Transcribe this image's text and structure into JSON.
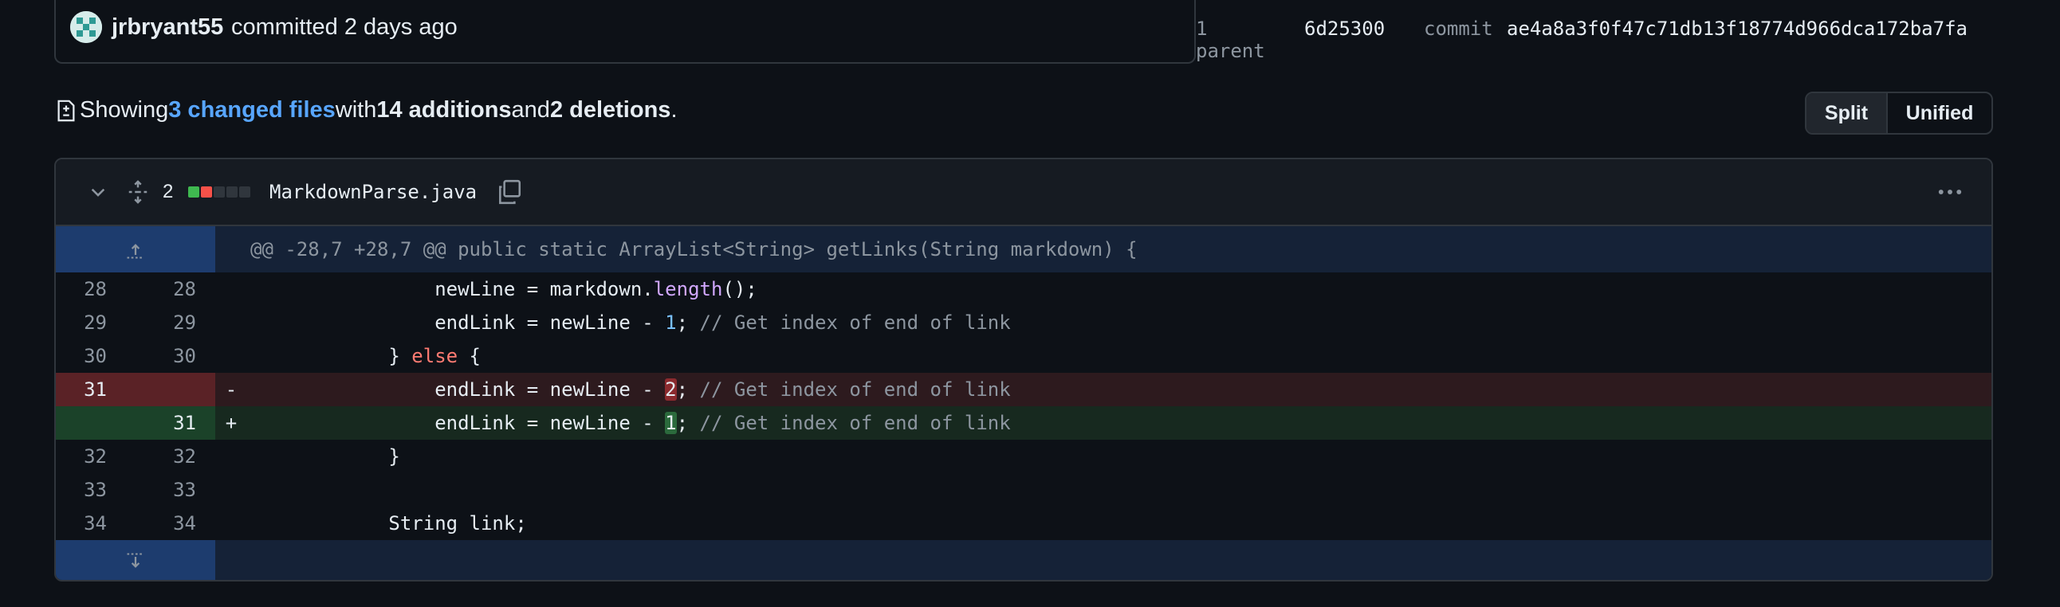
{
  "commit": {
    "author": "jrbryant55",
    "committed_text": "committed 2 days ago",
    "parent_label": "1 parent",
    "parent_sha": "6d25300",
    "commit_label": "commit",
    "commit_sha": "ae4a8a3f0f47c71db13f18774d966dca172ba7fa"
  },
  "summary": {
    "prefix": "Showing ",
    "files_link": "3 changed files",
    "with": " with ",
    "additions": "14 additions",
    "and": " and ",
    "deletions": "2 deletions",
    "suffix": "."
  },
  "view_toggle": {
    "split": "Split",
    "unified": "Unified"
  },
  "file": {
    "changes": "2",
    "name": "MarkdownParse.java",
    "diffstat": [
      "#3fb950",
      "#f85149",
      "#30363d",
      "#30363d",
      "#30363d"
    ],
    "hunk_header": "@@ -28,7 +28,7 @@ public static ArrayList<String> getLinks(String markdown) {",
    "lines": [
      {
        "type": "ctx",
        "old": "28",
        "new": "28"
      },
      {
        "type": "ctx",
        "old": "29",
        "new": "29"
      },
      {
        "type": "ctx",
        "old": "30",
        "new": "30"
      },
      {
        "type": "del",
        "old": "31",
        "new": "",
        "marker": "-"
      },
      {
        "type": "add",
        "old": "",
        "new": "31",
        "marker": "+"
      },
      {
        "type": "ctx",
        "old": "32",
        "new": "32"
      },
      {
        "type": "ctx",
        "old": "33",
        "new": "33"
      },
      {
        "type": "ctx",
        "old": "34",
        "new": "34"
      }
    ],
    "code": {
      "l28": {
        "indent": "                ",
        "a": "newLine = markdown.",
        "fn": "length",
        "b": "();"
      },
      "l29": {
        "indent": "                ",
        "a": "endLink = newLine - ",
        "num": "1",
        "b": "; ",
        "comment": "// Get index of end of link"
      },
      "l30": {
        "indent": "            ",
        "a": "} ",
        "kw": "else",
        "b": " {"
      },
      "l31d": {
        "indent": "                ",
        "a": "endLink = newLine - ",
        "num": "2",
        "b": "; ",
        "comment": "// Get index of end of link"
      },
      "l31a": {
        "indent": "                ",
        "a": "endLink = newLine - ",
        "num": "1",
        "b": "; ",
        "comment": "// Get index of end of link"
      },
      "l32": {
        "indent": "            ",
        "a": "}"
      },
      "l33": {
        "indent": ""
      },
      "l34": {
        "indent": "            ",
        "a": "String link;"
      }
    }
  },
  "icons": {
    "avatar": "identicon-avatar",
    "summary": "file-diff-icon",
    "collapse": "chevron-down-icon",
    "expand": "unfold-icon",
    "copy": "copy-icon",
    "more": "kebab-horizontal-icon",
    "expand_up": "expand-up-icon",
    "expand_down": "expand-down-icon"
  }
}
